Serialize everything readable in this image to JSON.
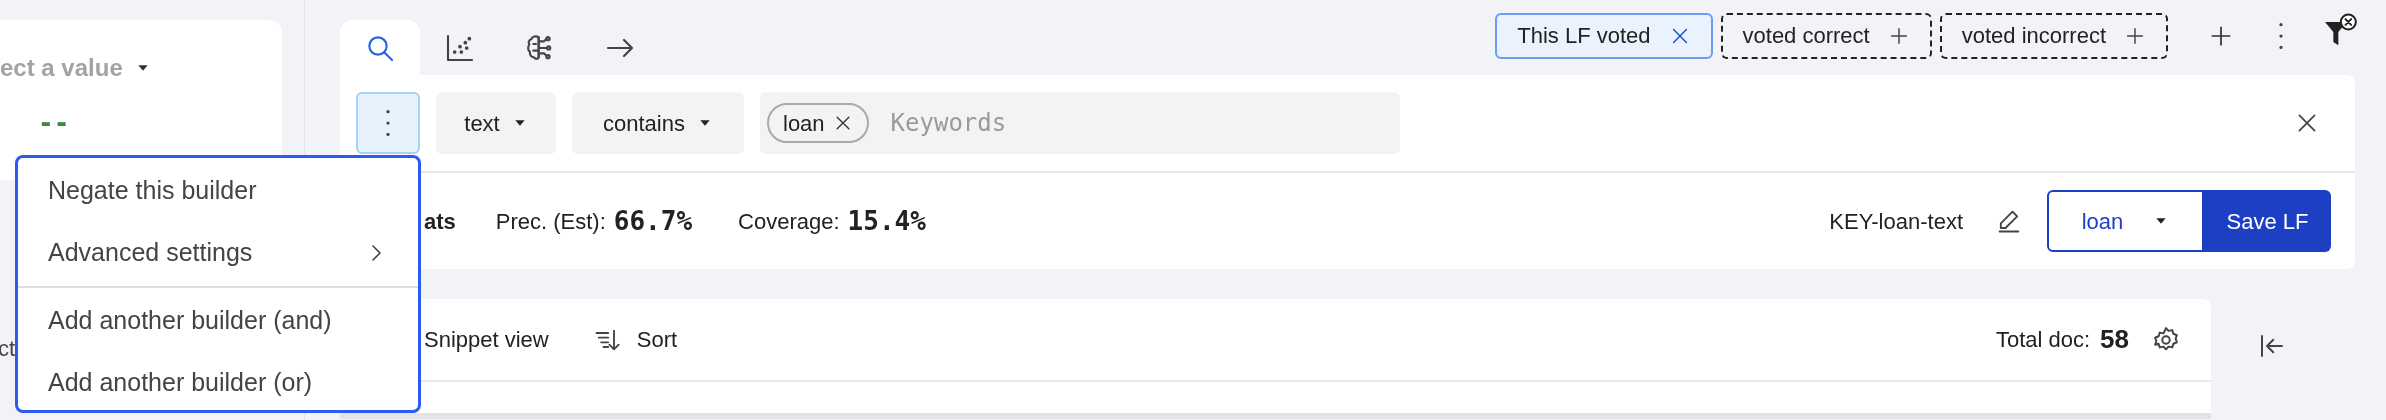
{
  "left_panel": {
    "select": "ect a value",
    "value": "--",
    "lower_text": "ct"
  },
  "tabs": [
    {
      "kind": "search",
      "selected": true
    },
    {
      "kind": "scatter",
      "selected": false
    },
    {
      "kind": "brain",
      "selected": false
    },
    {
      "kind": "arrow",
      "selected": false
    }
  ],
  "filter_chips": [
    {
      "label": "This LF voted",
      "kind": "active"
    },
    {
      "label": "voted correct",
      "kind": "add"
    },
    {
      "label": "voted incorrect",
      "kind": "add"
    }
  ],
  "builder": {
    "menu_open": true,
    "field": "text",
    "operator": "contains",
    "keywords": [
      "loan"
    ],
    "placeholder": "Keywords",
    "stats_label": "ats",
    "precision_label": "Prec. (Est):",
    "precision": "66.7%",
    "coverage_label": "Coverage:",
    "coverage": "15.4%",
    "lf_name": "KEY-loan-text",
    "label_value": "loan",
    "save": "Save LF"
  },
  "menu": {
    "groups": [
      [
        {
          "label": "Negate this builder",
          "submenu": false
        },
        {
          "label": "Advanced settings",
          "submenu": true
        }
      ],
      [
        {
          "label": "Add another builder (and)",
          "submenu": false
        },
        {
          "label": "Add another builder (or)",
          "submenu": false
        }
      ]
    ]
  },
  "documents": {
    "view": "Snippet view",
    "sort": "Sort",
    "total_label": "Total doc:",
    "total": "58"
  }
}
